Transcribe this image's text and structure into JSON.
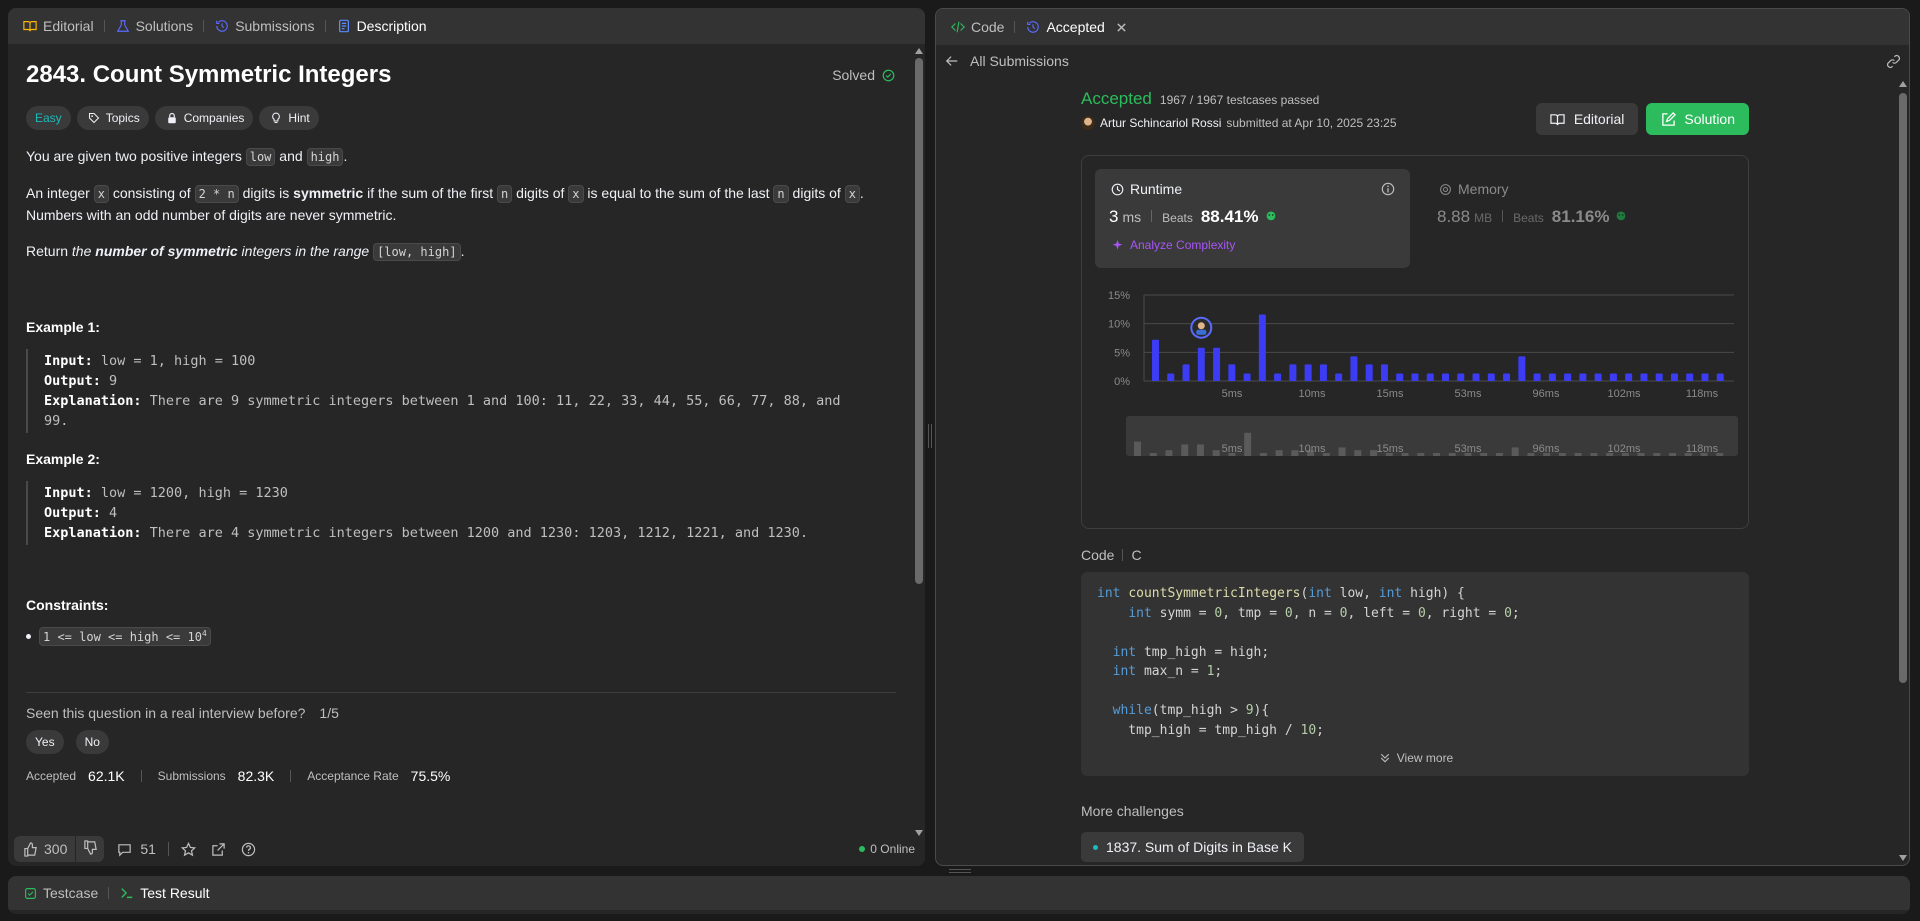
{
  "left_tabs": {
    "editorial": "Editorial",
    "solutions": "Solutions",
    "submissions": "Submissions",
    "description": "Description"
  },
  "problem": {
    "title": "2843. Count Symmetric Integers",
    "solved_label": "Solved",
    "difficulty": "Easy",
    "tags": [
      "Topics",
      "Companies",
      "Hint"
    ],
    "p1_a": "You are given two positive integers ",
    "p1_low": "low",
    "p1_b": " and ",
    "p1_high": "high",
    "p1_c": ".",
    "p2_a": "An integer ",
    "p2_x": "x",
    "p2_b": " consisting of ",
    "p2_2n": "2 * n",
    "p2_c": " digits is ",
    "p2_sym": "symmetric",
    "p2_d": " if the sum of the first ",
    "p2_n": "n",
    "p2_e": " digits of ",
    "p2_x2": "x",
    "p2_f": " is equal to the sum of the last ",
    "p2_n2": "n",
    "p2_g": " digits of ",
    "p2_x3": "x",
    "p2_h": ". Numbers with an odd number of digits are never symmetric.",
    "p3_a": "Return ",
    "p3_b": "the ",
    "p3_c": "number of symmetric",
    "p3_d": " integers in the range ",
    "p3_range": "[low, high]",
    "p3_e": ".",
    "example1_title": "Example 1:",
    "ex1_input_label": "Input:",
    "ex1_input": " low = 1, high = 100",
    "ex1_output_label": "Output:",
    "ex1_output": " 9",
    "ex1_expl_label": "Explanation:",
    "ex1_expl": " There are 9 symmetric integers between 1 and 100: 11, 22, 33, 44, 55, 66, 77, 88, and",
    "ex1_expl2": "99.",
    "example2_title": "Example 2:",
    "ex2_input_label": "Input:",
    "ex2_input": " low = 1200, high = 1230",
    "ex2_output_label": "Output:",
    "ex2_output": " 4",
    "ex2_expl_label": "Explanation:",
    "ex2_expl": " There are 4 symmetric integers between 1200 and 1230: 1203, 1212, 1221, and 1230.",
    "constraints_title": "Constraints:",
    "constraint1": "1 <= low <= high <= 10",
    "constraint1_sup": "4",
    "interview_q": "Seen this question in a real interview before?",
    "interview_ratio": "1/5",
    "yes": "Yes",
    "no": "No",
    "accepted_label": "Accepted",
    "accepted_val": "62.1K",
    "submissions_label": "Submissions",
    "submissions_val": "82.3K",
    "rate_label": "Acceptance Rate",
    "rate_val": "75.5%"
  },
  "left_footer": {
    "likes": "300",
    "comments": "51",
    "online": "0 Online"
  },
  "right_tabs": {
    "code": "Code",
    "accepted": "Accepted"
  },
  "right_sub": {
    "back_label": "All Submissions"
  },
  "result": {
    "status": "Accepted",
    "testcases": "1967 / 1967 testcases passed",
    "user": "Artur Schincariol Rossi",
    "submitted": "submitted at Apr 10, 2025 23:25",
    "editorial_btn": "Editorial",
    "solution_btn": "Solution",
    "runtime_label": "Runtime",
    "runtime_val": "3",
    "runtime_unit": "ms",
    "beats_label": "Beats",
    "runtime_beats": "88.41%",
    "analyze": "Analyze Complexity",
    "memory_label": "Memory",
    "memory_val": "8.88",
    "memory_unit": "MB",
    "memory_beats": "81.16%"
  },
  "chart_data": {
    "type": "bar",
    "y_ticks": [
      "15%",
      "10%",
      "5%",
      "0%"
    ],
    "x_ticks": [
      "5ms",
      "10ms",
      "15ms",
      "53ms",
      "96ms",
      "102ms",
      "118ms"
    ],
    "ylim": [
      0,
      15
    ],
    "values": [
      7.2,
      1.3,
      2.9,
      5.8,
      5.8,
      2.9,
      1.3,
      11.6,
      1.3,
      2.9,
      2.9,
      2.9,
      1.3,
      4.3,
      2.9,
      2.9,
      1.3,
      1.3,
      1.3,
      1.3,
      1.3,
      1.3,
      1.3,
      1.3,
      4.3,
      1.3,
      1.3,
      1.3,
      1.3,
      1.3,
      1.3,
      1.3,
      1.3,
      1.3,
      1.3,
      1.3,
      1.3,
      1.3
    ],
    "highlight_index": 3,
    "bar_color": "#3c3cf4"
  },
  "code_section": {
    "label": "Code",
    "lang": "C",
    "lines": [
      [
        [
          "kw",
          "int "
        ],
        [
          "fn",
          "countSymmetricIntegers"
        ],
        [
          "txt",
          "("
        ],
        [
          "kw",
          "int "
        ],
        [
          "txt",
          "low, "
        ],
        [
          "kw",
          "int "
        ],
        [
          "txt",
          "high) {"
        ]
      ],
      [
        [
          "txt",
          "    "
        ],
        [
          "kw",
          "int "
        ],
        [
          "txt",
          "symm = "
        ],
        [
          "num",
          "0"
        ],
        [
          "txt",
          ", tmp = "
        ],
        [
          "num",
          "0"
        ],
        [
          "txt",
          ", n = "
        ],
        [
          "num",
          "0"
        ],
        [
          "txt",
          ", left = "
        ],
        [
          "num",
          "0"
        ],
        [
          "txt",
          ", right = "
        ],
        [
          "num",
          "0"
        ],
        [
          "txt",
          ";"
        ]
      ],
      [],
      [
        [
          "txt",
          "  "
        ],
        [
          "kw",
          "int "
        ],
        [
          "txt",
          "tmp_high = high;"
        ]
      ],
      [
        [
          "txt",
          "  "
        ],
        [
          "kw",
          "int "
        ],
        [
          "txt",
          "max_n = "
        ],
        [
          "num",
          "1"
        ],
        [
          "txt",
          ";"
        ]
      ],
      [],
      [
        [
          "txt",
          "  "
        ],
        [
          "kw",
          "while"
        ],
        [
          "txt",
          "(tmp_high > "
        ],
        [
          "num",
          "9"
        ],
        [
          "txt",
          "){"
        ]
      ],
      [
        [
          "txt",
          "    tmp_high = tmp_high / "
        ],
        [
          "num",
          "10"
        ],
        [
          "txt",
          ";"
        ]
      ]
    ],
    "view_more": "View more"
  },
  "more": {
    "title": "More challenges",
    "item1": "1837. Sum of Digits in Base K"
  },
  "bottom": {
    "testcase": "Testcase",
    "test_result": "Test Result"
  },
  "colors": {
    "accent_green": "#2cbb5d",
    "easy": "#1cbaba",
    "purple": "#a855f7",
    "bar": "#3c3cf4"
  }
}
